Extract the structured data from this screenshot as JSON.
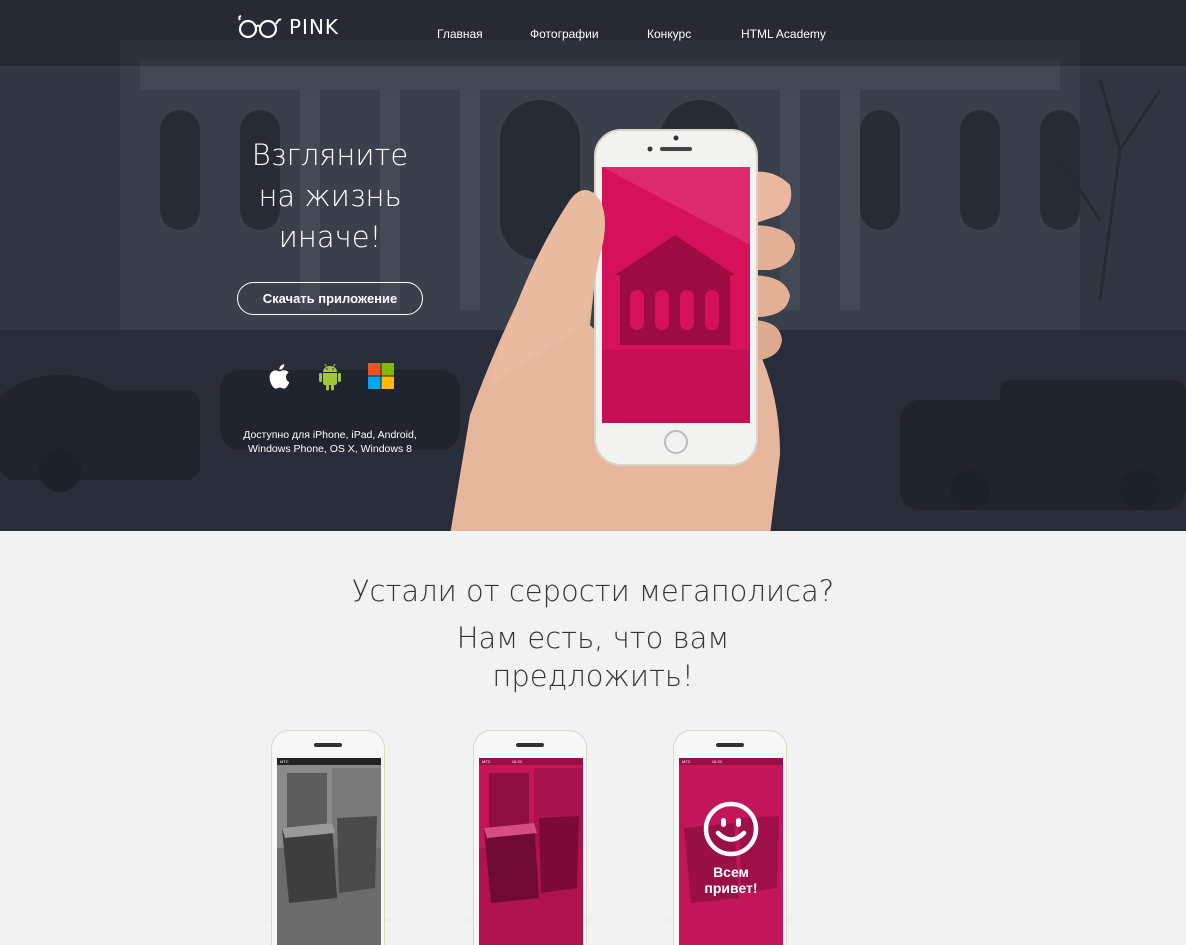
{
  "header": {
    "logo_text": "PINK",
    "nav": [
      "Главная",
      "Фотографии",
      "Конкурс",
      "HTML Academy"
    ]
  },
  "hero": {
    "title_lines": [
      "Взгляните",
      "на жизнь",
      "иначе!"
    ],
    "download_button": "Скачать приложение",
    "platform_icons": [
      "apple-icon",
      "android-icon",
      "windows-icon"
    ],
    "available_lines": [
      "Доступно для iPhone, iPad, Android,",
      "Windows Phone, OS X, Windows 8"
    ]
  },
  "promo": {
    "title": "Устали от серости мегаполиса?",
    "subtitle_lines": [
      "Нам есть, что вам",
      "предложить!"
    ],
    "phones": [
      {
        "status": "МТС",
        "time": "",
        "type": "photo-bw"
      },
      {
        "status": "МТС",
        "time": "16:20",
        "type": "photo-pink"
      },
      {
        "status": "МТС",
        "time": "16:20",
        "type": "smile",
        "greeting": [
          "Всем",
          "привет!"
        ]
      }
    ]
  },
  "colors": {
    "accent": "#d5115a",
    "hero_bg": "#2f3340",
    "page_bg": "#f2f2f2"
  }
}
